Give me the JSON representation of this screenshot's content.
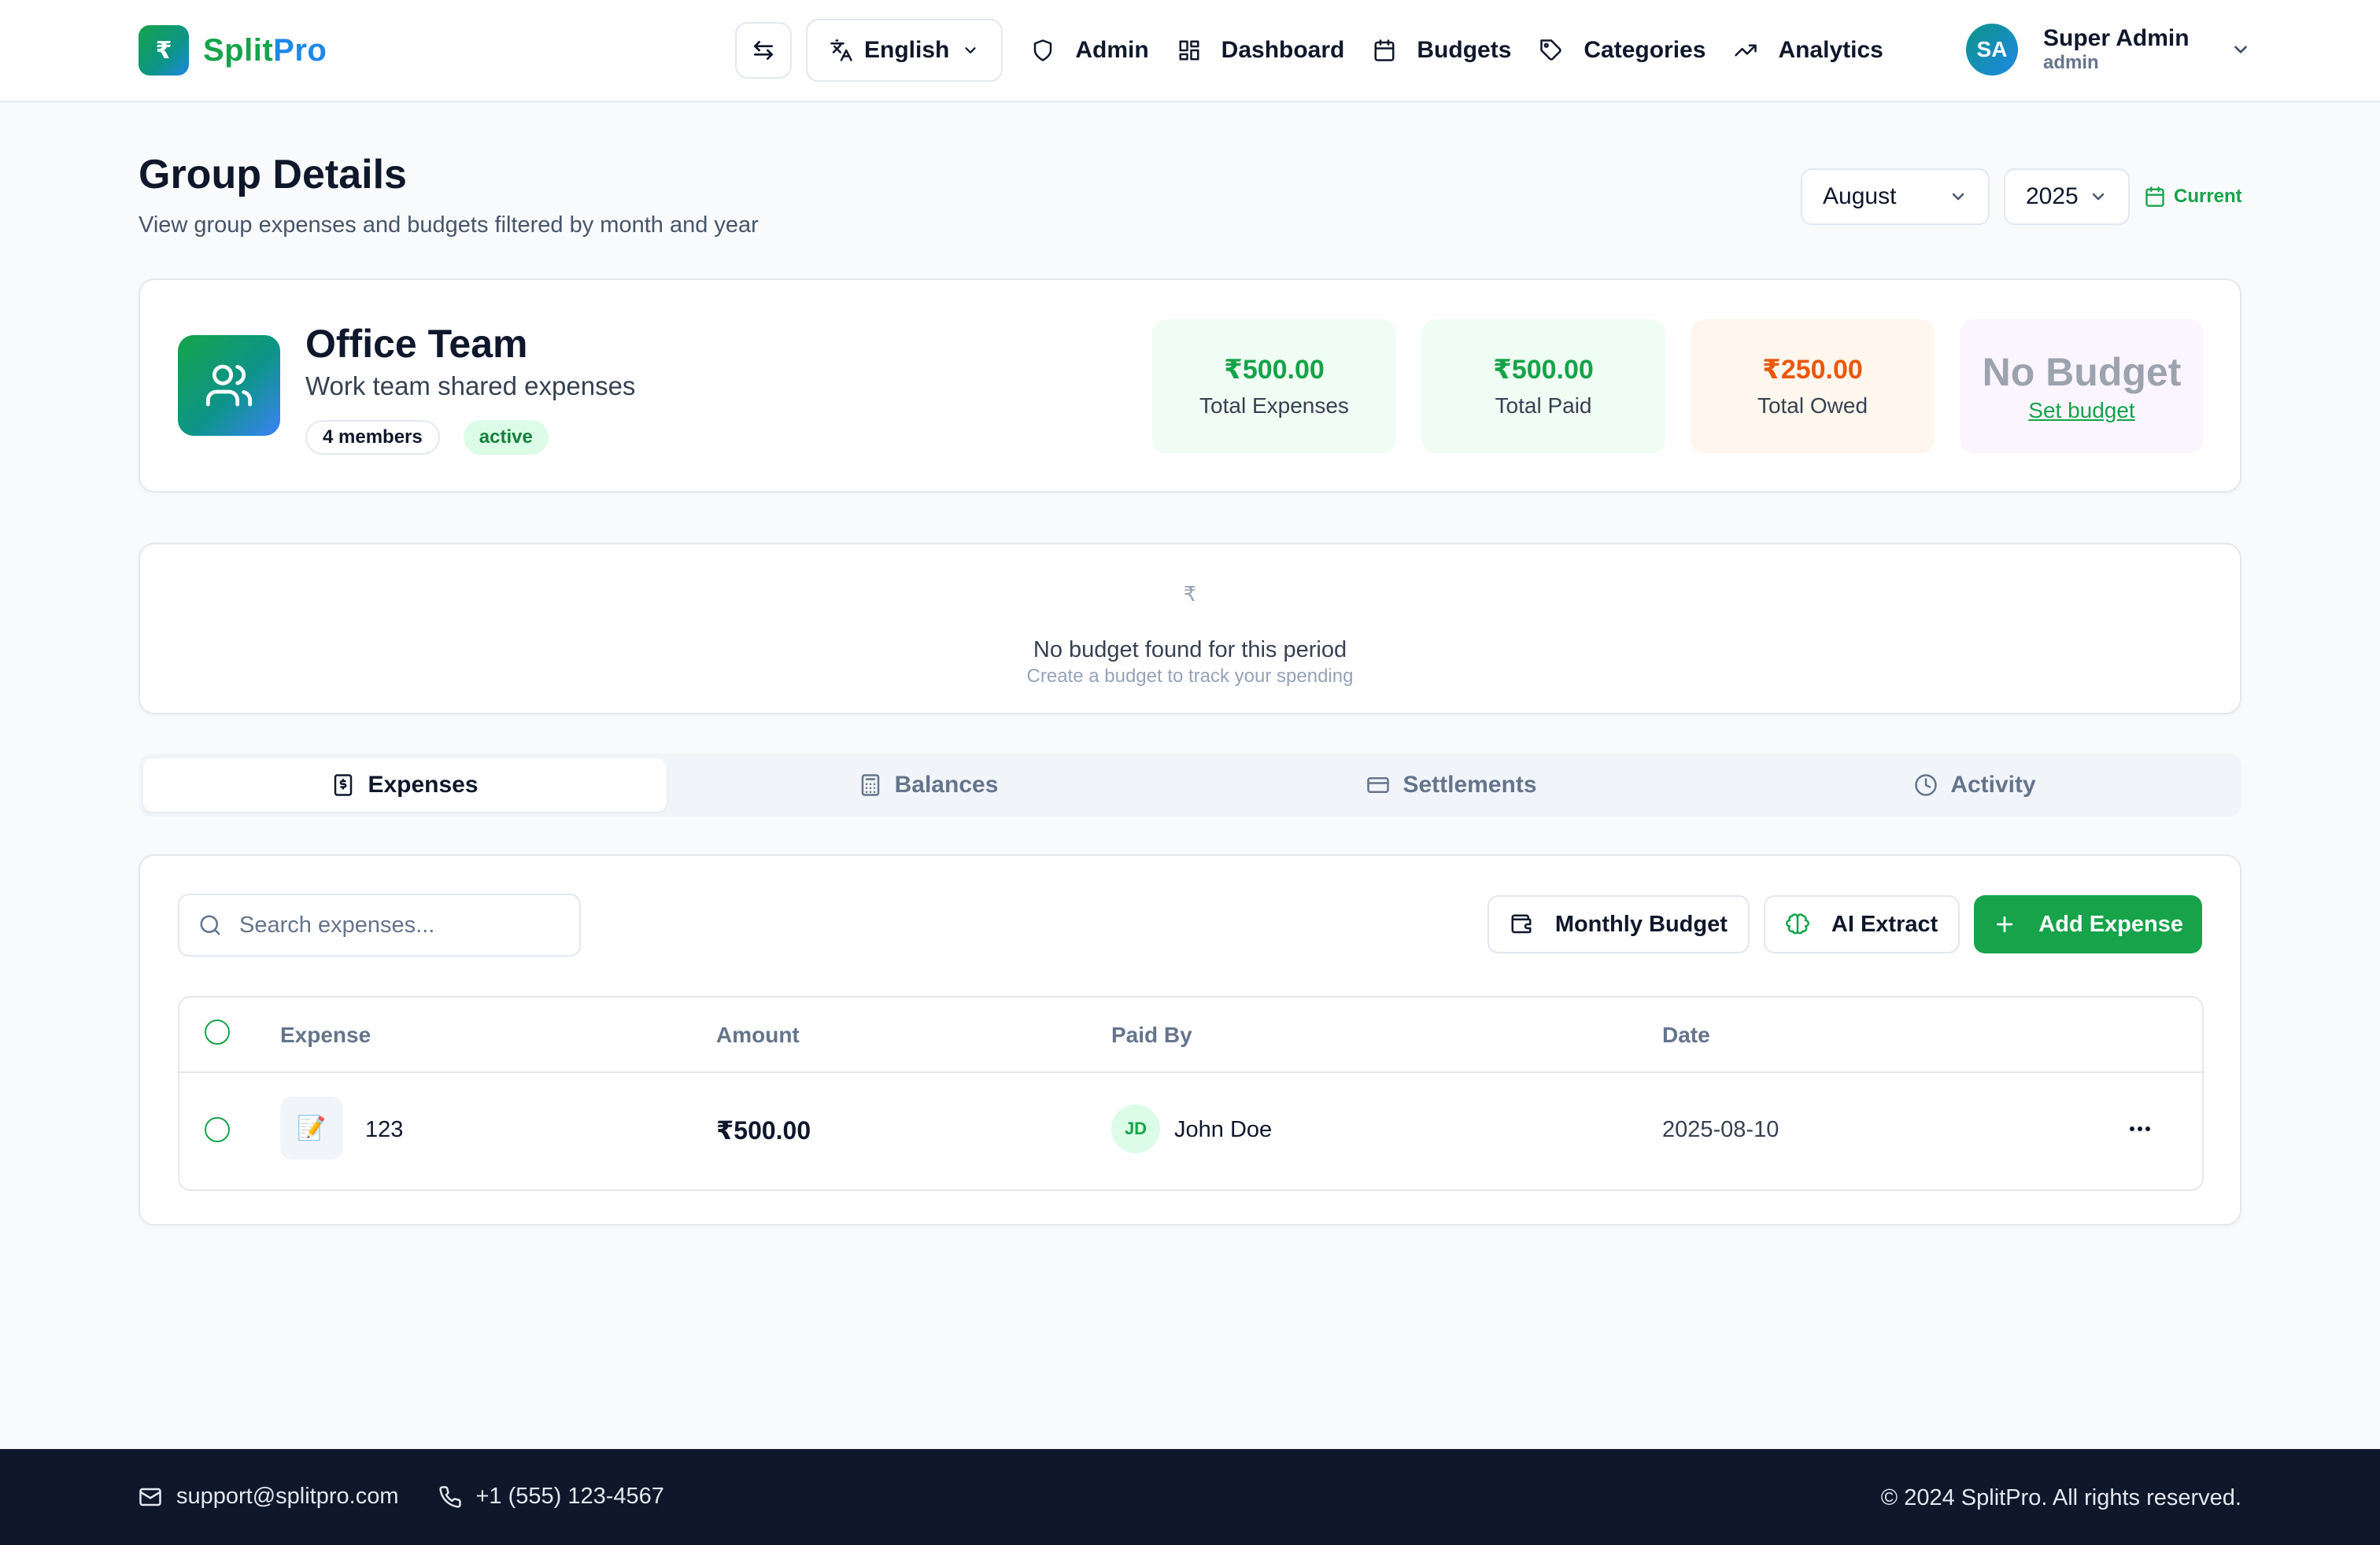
{
  "app": {
    "brand": {
      "first": "Split",
      "second": "Pro",
      "logo_glyph": "₹"
    },
    "colors": {
      "accent": "#16a34a",
      "warning": "#ea580c",
      "footer_bg": "#0f172a"
    }
  },
  "header": {
    "language": "English",
    "nav": [
      {
        "label": "Admin",
        "icon": "shield-icon"
      },
      {
        "label": "Dashboard",
        "icon": "dashboard-grid-icon"
      },
      {
        "label": "Budgets",
        "icon": "calendar-icon"
      },
      {
        "label": "Categories",
        "icon": "tag-icon"
      },
      {
        "label": "Analytics",
        "icon": "trending-up-icon"
      }
    ],
    "user": {
      "initials": "SA",
      "name": "Super Admin",
      "role": "admin"
    }
  },
  "page": {
    "title": "Group Details",
    "subtitle": "View group expenses and budgets filtered by month and year",
    "month": "August",
    "year": "2025",
    "current_label": "Current"
  },
  "group": {
    "name": "Office Team",
    "description": "Work team shared expenses",
    "members_badge": "4 members",
    "status": "active",
    "stats": {
      "total_expenses": {
        "value": "₹500.00",
        "label": "Total Expenses"
      },
      "total_paid": {
        "value": "₹500.00",
        "label": "Total Paid"
      },
      "total_owed": {
        "value": "₹250.00",
        "label": "Total Owed"
      },
      "budget": {
        "value": "No Budget",
        "link": "Set budget"
      }
    }
  },
  "budget_notice": {
    "glyph": "₹",
    "title": "No budget found for this period",
    "hint": "Create a budget to track your spending"
  },
  "tabs": [
    {
      "label": "Expenses",
      "active": true
    },
    {
      "label": "Balances",
      "active": false
    },
    {
      "label": "Settlements",
      "active": false
    },
    {
      "label": "Activity",
      "active": false
    }
  ],
  "expenses": {
    "search_placeholder": "Search expenses...",
    "buttons": {
      "monthly_budget": "Monthly Budget",
      "ai_extract": "AI Extract",
      "add_expense": "Add Expense"
    },
    "columns": {
      "expense": "Expense",
      "amount": "Amount",
      "paid_by": "Paid By",
      "date": "Date"
    },
    "rows": [
      {
        "emoji": "📝",
        "name": "123",
        "amount": "₹500.00",
        "payer_initials": "JD",
        "payer_name": "John Doe",
        "date": "2025-08-10"
      }
    ]
  },
  "footer": {
    "email": "support@splitpro.com",
    "phone": "+1 (555) 123-4567",
    "copyright": "© 2024 SplitPro. All rights reserved."
  }
}
